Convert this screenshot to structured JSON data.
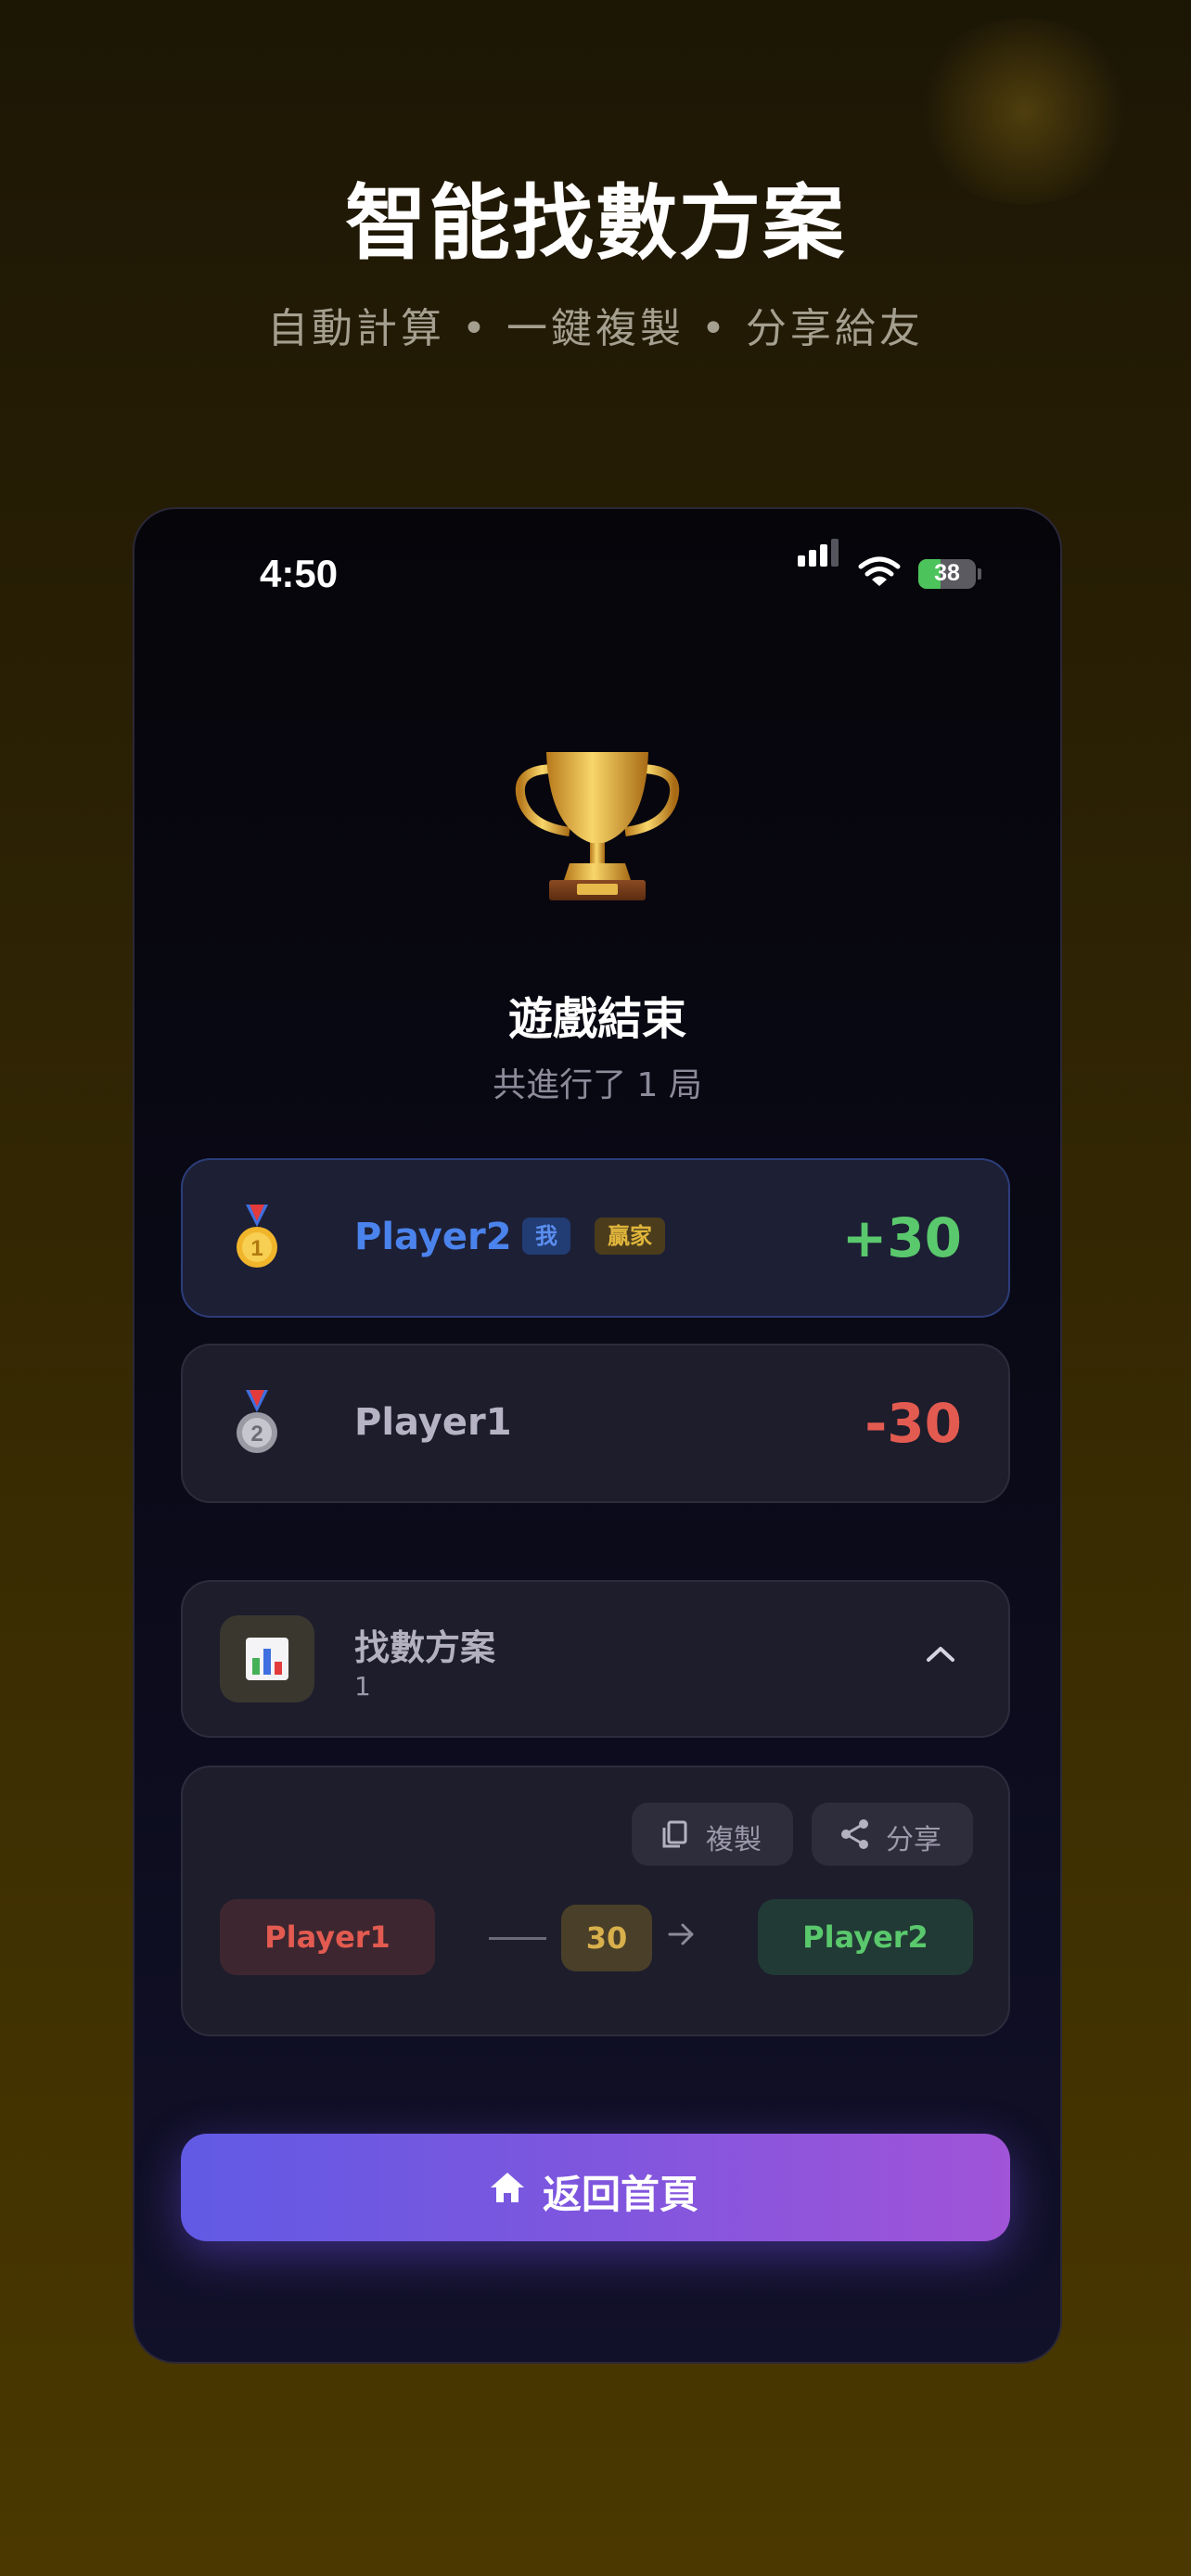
{
  "hero": {
    "title": "智能找數方案",
    "subtitle": "自動計算 • 一鍵複製 • 分享給友"
  },
  "status_bar": {
    "time": "4:50",
    "battery": "38",
    "battery_level": 0.38,
    "icons": [
      "cellular-signal-icon",
      "wifi-icon",
      "battery-charging-icon"
    ]
  },
  "result": {
    "trophy_icon": "trophy-icon",
    "title": "遊戲結束",
    "rounds_text": "共進行了 1 局"
  },
  "players": [
    {
      "rank_icon": "gold-medal-icon",
      "name": "Player2",
      "me_tag": "我",
      "winner_tag": "贏家",
      "score": "+30"
    },
    {
      "rank_icon": "silver-medal-icon",
      "name": "Player1",
      "score": "-30"
    }
  ],
  "plan": {
    "icon": "bar-chart-icon",
    "title": "找數方案",
    "count": "1",
    "toggle_icon": "chevron-up-icon"
  },
  "transfer": {
    "copy_label": "複製",
    "share_label": "分享",
    "from": "Player1",
    "amount": "30",
    "to": "Player2"
  },
  "actions": {
    "home_label": "返回首頁",
    "home_icon": "home-icon"
  },
  "colors": {
    "accent_start": "#615ae4",
    "accent_end": "#a054d8",
    "positive": "#5ac86c",
    "negative": "#e35b50",
    "player_me": "#4b83ec",
    "winner_badge": "#e0b53b"
  }
}
